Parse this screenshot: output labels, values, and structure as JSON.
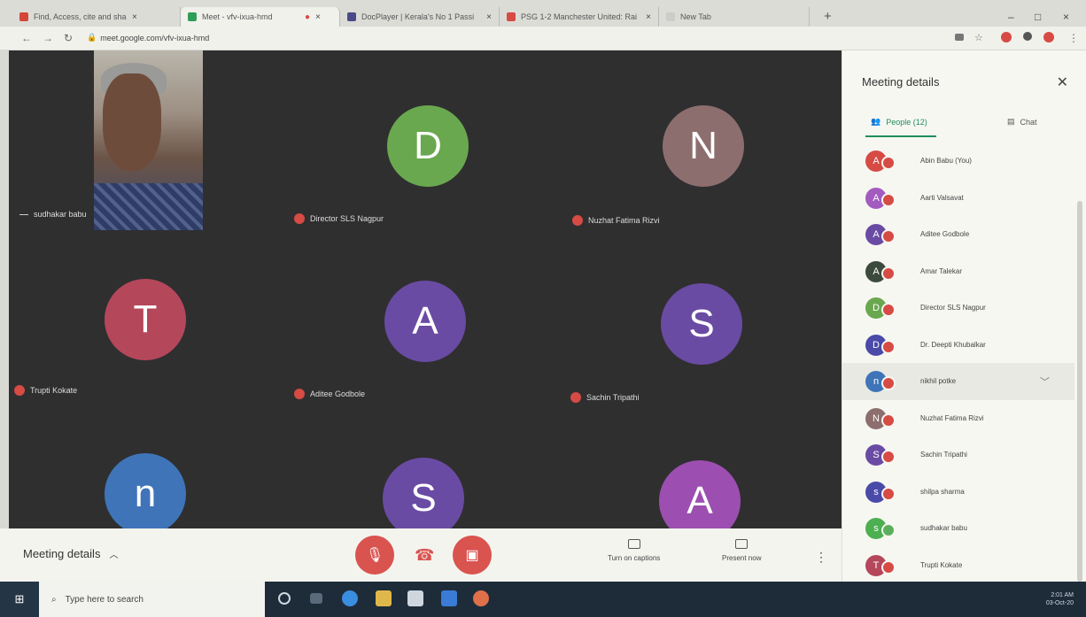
{
  "colors": {
    "meet_bg": "#2f2f30",
    "mute_red": "#d64b44",
    "accent_green": "#1e8e5a"
  },
  "browser": {
    "tabs": [
      {
        "title": "Find, Access, cite and share the",
        "favicon": "gmail-icon",
        "color": "#d44638"
      },
      {
        "title": "Meet - vfv-ixua-hmd",
        "favicon": "meet-icon",
        "color": "#2e9e58",
        "recording_dot": "●"
      },
      {
        "title": "DocPlayer | Kerala's No 1 Passi",
        "favicon": "d-icon",
        "color": "#4a4a8a"
      },
      {
        "title": "PSG 1-2 Manchester United: Rai",
        "favicon": "x-icon",
        "color": "#d64b44"
      },
      {
        "title": "New Tab",
        "favicon": "blank-icon",
        "color": "#cccccc"
      }
    ],
    "url": "meet.google.com/vfv-ixua-hmd"
  },
  "tiles": [
    {
      "name": "sudhakar babu",
      "kind": "video"
    },
    {
      "initial": "D",
      "name": "Director SLS Nagpur",
      "color": "#6aa84f"
    },
    {
      "initial": "N",
      "name": "Nuzhat Fatima Rizvi",
      "color": "#8d6e6e"
    },
    {
      "initial": "T",
      "name": "Trupti Kokate",
      "color": "#b5475b"
    },
    {
      "initial": "A",
      "name": "Aditee Godbole",
      "color": "#6a4ba3"
    },
    {
      "initial": "S",
      "name": "Sachin Tripathi",
      "color": "#6a4ba3"
    },
    {
      "initial": "n",
      "name": "",
      "color": "#3f74b8"
    },
    {
      "initial": "S",
      "name": "",
      "color": "#6a4ba3"
    },
    {
      "initial": "A",
      "name": "",
      "color": "#9c4fb0"
    }
  ],
  "controls": {
    "meeting_details": "Meeting details",
    "captions": "Turn on captions",
    "present": "Present now"
  },
  "panel": {
    "title": "Meeting details",
    "people_tab": "People (12)",
    "chat_tab": "Chat",
    "people": [
      {
        "initial": "A",
        "name": "Abin Babu (You)",
        "color": "#d64b44"
      },
      {
        "initial": "A",
        "name": "Aarti Valsavat",
        "color": "#a35bc0"
      },
      {
        "initial": "A",
        "name": "Aditee Godbole",
        "color": "#6a4ba3"
      },
      {
        "initial": "A",
        "name": "Amar Talekar",
        "color": "#3c4a3c"
      },
      {
        "initial": "D",
        "name": "Director SLS Nagpur",
        "color": "#6aa84f"
      },
      {
        "initial": "D",
        "name": "Dr. Deepti Khubalkar",
        "color": "#4a4aa8"
      },
      {
        "initial": "n",
        "name": "nikhil potke",
        "color": "#3f74b8"
      },
      {
        "initial": "N",
        "name": "Nuzhat Fatima Rizvi",
        "color": "#8d6e6e"
      },
      {
        "initial": "S",
        "name": "Sachin Tripathi",
        "color": "#6a4ba3"
      },
      {
        "initial": "s",
        "name": "shilpa sharma",
        "color": "#4a4aa8"
      },
      {
        "initial": "s",
        "name": "sudhakar babu",
        "color": "#4caf50"
      },
      {
        "initial": "T",
        "name": "Trupti Kokate",
        "color": "#b5475b"
      }
    ]
  },
  "taskbar": {
    "search_placeholder": "Type here to search",
    "time": "2:01 AM",
    "date": "03-Oct-20"
  }
}
